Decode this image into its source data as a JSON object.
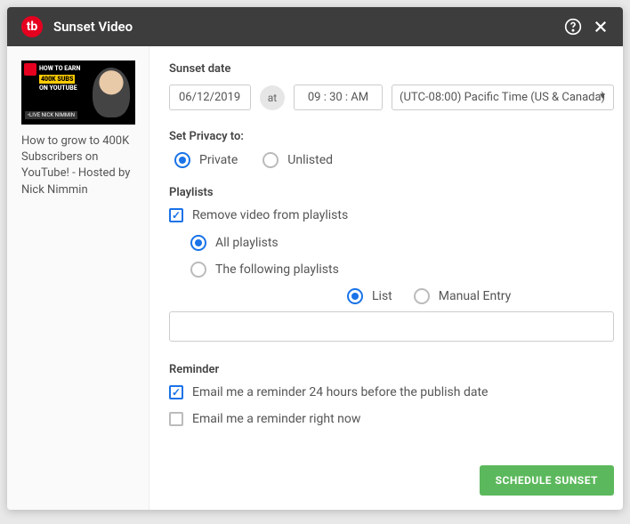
{
  "header": {
    "title": "Sunset Video"
  },
  "video": {
    "thumb_line1": "HOW TO EARN",
    "thumb_subs": "400K SUBS",
    "thumb_line2": "ON YOUTUBE",
    "thumb_live": "•LIVE  NICK NIMMIN",
    "title": "How to grow to 400K Subscribers on YouTube! - Hosted by Nick Nimmin"
  },
  "sunset": {
    "label": "Sunset date",
    "date": "06/12/2019",
    "at": "at",
    "time": "09 : 30 : AM",
    "tz": "(UTC-08:00) Pacific Time (US & Canada)"
  },
  "privacy": {
    "label": "Set Privacy to:",
    "private": "Private",
    "unlisted": "Unlisted"
  },
  "playlists": {
    "label": "Playlists",
    "remove": "Remove video from playlists",
    "all": "All playlists",
    "following": "The following playlists",
    "list": "List",
    "manual": "Manual Entry"
  },
  "reminder": {
    "label": "Reminder",
    "r24": "Email me a reminder 24 hours before the publish date",
    "rnow": "Email me a reminder right now"
  },
  "actions": {
    "schedule": "SCHEDULE SUNSET"
  }
}
